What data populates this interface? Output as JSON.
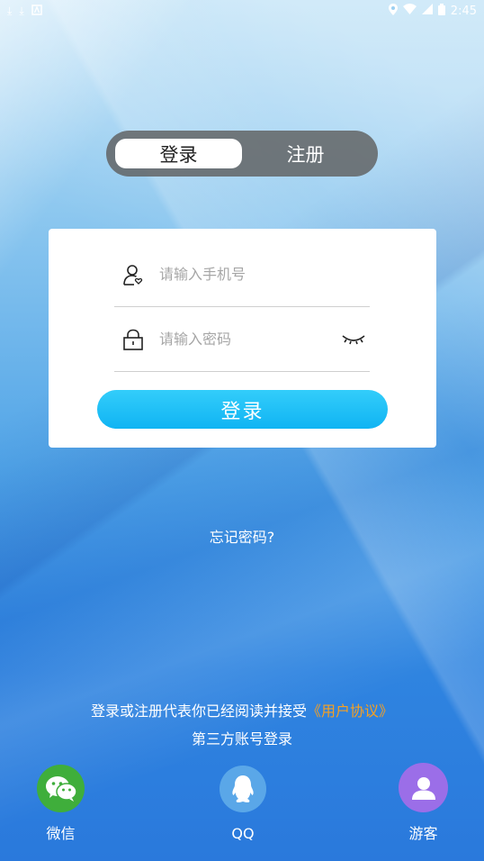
{
  "status_bar": {
    "time": "2:45"
  },
  "tabs": {
    "login": "登录",
    "register": "注册"
  },
  "form": {
    "phone_placeholder": "请输入手机号",
    "password_placeholder": "请输入密码",
    "login_button": "登录"
  },
  "links": {
    "forgot_password": "忘记密码?"
  },
  "agreement": {
    "prefix": "登录或注册代表你已经阅读并接受",
    "link": "《用户协议》"
  },
  "third_party": {
    "title": "第三方账号登录",
    "wechat": "微信",
    "qq": "QQ",
    "guest": "游客"
  },
  "colors": {
    "accent": "#10b4f3",
    "agreement_link": "#f7a021",
    "wechat": "#3fae3b",
    "guest": "#9b6ee8"
  }
}
